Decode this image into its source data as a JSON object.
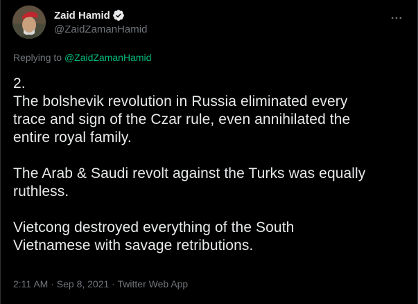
{
  "tweet": {
    "author": {
      "display_name": "Zaid Hamid",
      "handle": "@ZaidZamanHamid",
      "verified": true
    },
    "replying_prefix": "Replying to ",
    "replying_to": "@ZaidZamanHamid",
    "text": "2.\nThe bolshevik revolution in Russia eliminated every\ntrace and sign of the Czar rule, even annihilated the\nentire royal family.\n\nThe Arab & Saudi revolt against the Turks was equally\nruthless.\n\nVietcong destroyed everything of the South\nVietnamese with savage retributions.",
    "time": "2:11 AM",
    "date": "Sep 8, 2021",
    "source": "Twitter Web App",
    "separator": " · "
  },
  "icons": {
    "verified": "verified-badge-icon",
    "more": "more-options-icon"
  },
  "colors": {
    "background": "#000000",
    "text_primary": "#e7e9ea",
    "text_secondary": "#71767b",
    "mention": "#00ba7c",
    "beret": "#c0262d"
  }
}
